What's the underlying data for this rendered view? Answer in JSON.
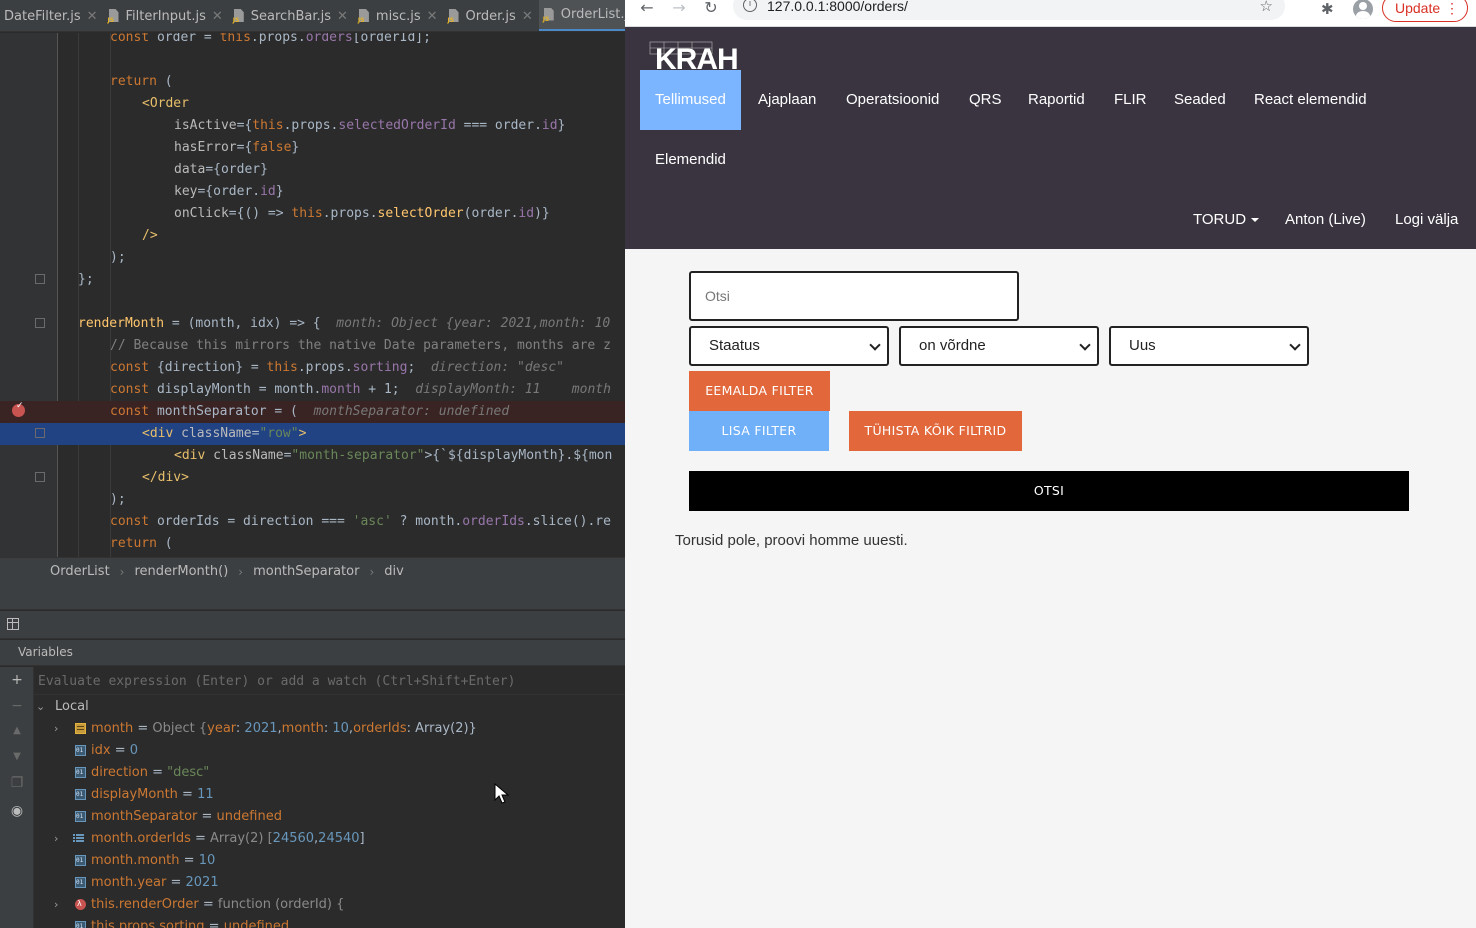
{
  "ide": {
    "tabs": [
      {
        "label": "DateFilter.js",
        "active": false
      },
      {
        "label": "FilterInput.js",
        "active": false
      },
      {
        "label": "SearchBar.js",
        "active": false
      },
      {
        "label": "misc.js",
        "active": false
      },
      {
        "label": "Order.js",
        "active": false
      },
      {
        "label": "OrderList.js",
        "active": true
      }
    ],
    "code": {
      "l0a": "const ",
      "l0b": "order = ",
      "l0c": "this",
      "l0d": ".props.",
      "l0e": "orders",
      "l0f": "[orderId];",
      "l1a": "return ",
      "l1b": "(",
      "l2a": "<",
      "l2b": "Order",
      "l3a": "isActive",
      "l3b": "={",
      "l3c": "this",
      "l3d": ".props.",
      "l3e": "selectedOrderId",
      "l3f": " === order.",
      "l3g": "id",
      "l3h": "}",
      "l4a": "hasError",
      "l4b": "={",
      "l4c": "false",
      "l4d": "}",
      "l5a": "data",
      "l5b": "={order}",
      "l6a": "key",
      "l6b": "={order.",
      "l6c": "id",
      "l6d": "}",
      "l7a": "onClick",
      "l7b": "={() => ",
      "l7c": "this",
      "l7d": ".props.",
      "l7e": "selectOrder",
      "l7f": "(order.",
      "l7g": "id",
      "l7h": ")}",
      "l8a": "/>",
      "l9a": ");",
      "l10a": "};",
      "l11a": "renderMonth",
      "l11b": " = (month, idx) => {",
      "l11c": "  month: Object {year: 2021,month: 10",
      "l12a": "// Because this mirrors the native Date parameters, months are z",
      "l13a": "const ",
      "l13b": "{direction} = ",
      "l13c": "this",
      "l13d": ".props.",
      "l13e": "sorting",
      "l13f": ";",
      "l13g": "  direction: \"desc\"",
      "l14a": "const ",
      "l14b": "displayMonth = month.",
      "l14c": "month",
      "l14d": " + 1;",
      "l14e": "  displayMonth: 11    month",
      "l15a": "const ",
      "l15b": "monthSeparator = (",
      "l15c": "  monthSeparator: undefined",
      "l16a": "<",
      "l16b": "div ",
      "l16c": "className",
      "l16d": "=",
      "l16e": "\"row\"",
      "l16f": ">",
      "l17a": "<",
      "l17b": "div ",
      "l17c": "className",
      "l17d": "=",
      "l17e": "\"month-separator\"",
      "l17f": ">{`${displayMonth}.${mon",
      "l18a": "</",
      "l18b": "div",
      "l18c": ">",
      "l19a": ");",
      "l20a": "const ",
      "l20b": "orderIds = direction === ",
      "l20c": "'asc'",
      "l20d": " ? month.",
      "l20e": "orderIds",
      "l20f": ".slice().re",
      "l21a": "return ",
      "l21b": "("
    },
    "breadcrumb": [
      "OrderList",
      "renderMonth()",
      "monthSeparator",
      "div"
    ],
    "debugger": {
      "panel_title": "Variables",
      "eval_placeholder": "Evaluate expression (Enter) or add a watch (Ctrl+Shift+Enter)",
      "scope": "Local",
      "vars": {
        "month_name": "month",
        "month_eq": " = ",
        "month_type": "Object {",
        "month_k1": "year",
        "month_c1": ": ",
        "month_v1": "2021",
        "month_s1": ",",
        "month_k2": "month",
        "month_c2": ": ",
        "month_v2": "10",
        "month_s2": ",",
        "month_k3": "orderIds",
        "month_c3": ": ",
        "month_v3": "Array(2)",
        "month_end": "}",
        "idx_name": "idx",
        "idx_eq": " = ",
        "idx_val": "0",
        "dir_name": "direction",
        "dir_eq": " = ",
        "dir_val": "\"desc\"",
        "dm_name": "displayMonth",
        "dm_eq": " = ",
        "dm_val": "11",
        "ms_name": "monthSeparator",
        "ms_eq": " = ",
        "ms_val": "undefined",
        "oi_name": "month.orderIds",
        "oi_eq": " = ",
        "oi_type": "Array(2) [",
        "oi_v1": "24560",
        "oi_s": ",",
        "oi_v2": "24540",
        "oi_end": "]",
        "mm_name": "month.month",
        "mm_eq": " = ",
        "mm_val": "10",
        "my_name": "month.year",
        "my_eq": " = ",
        "my_val": "2021",
        "ro_name": "this.renderOrder",
        "ro_eq": " = ",
        "ro_val": "function (orderId) {",
        "ps_name": "this.props.sorting",
        "ps_eq": " = ",
        "ps_val": "undefined"
      }
    }
  },
  "browser": {
    "url": "127.0.0.1:8000/orders/",
    "update_label": "Update",
    "site": {
      "logo_text": "KRAH",
      "nav": [
        {
          "label": "Tellimused",
          "active": true
        },
        {
          "label": "Ajaplaan",
          "active": false
        },
        {
          "label": "Operatsioonid",
          "active": false
        },
        {
          "label": "QRS",
          "active": false
        },
        {
          "label": "Raportid",
          "active": false
        },
        {
          "label": "FLIR",
          "active": false
        },
        {
          "label": "Seaded",
          "active": false
        },
        {
          "label": "React elemendid",
          "active": false
        },
        {
          "label": "Elemendid",
          "active": false
        }
      ],
      "right_nav": {
        "dropdown": "TORUD",
        "user": "Anton (Live)",
        "logout": "Logi välja"
      },
      "nav_colors": {
        "bg": "#3a3440",
        "active": "#7bb4ff"
      }
    },
    "search": {
      "placeholder": "Otsi",
      "filter": {
        "field": "Staatus",
        "operator": "on võrdne",
        "value": "Uus"
      },
      "remove_filter": "Eemalda filter",
      "add_filter": "Lisa filter",
      "clear_filters": "Tühista kõik filtrid",
      "submit": "Otsi"
    },
    "empty_message": "Torusid pole, proovi homme uuesti.",
    "button_colors": {
      "orange": "#e2683c",
      "blue": "#6fb0f9",
      "black": "#000000"
    }
  }
}
